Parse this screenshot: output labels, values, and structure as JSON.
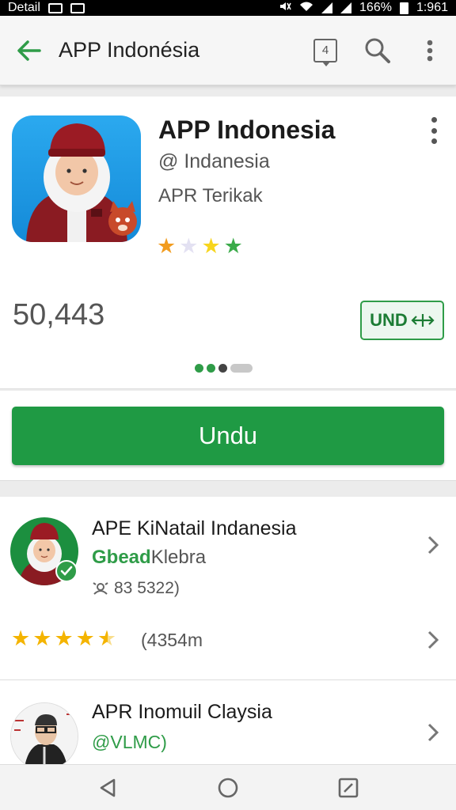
{
  "status_bar": {
    "left_text": "Detail",
    "right_percent": "166%",
    "time": "1:961"
  },
  "app_bar": {
    "title": "APP Indonésia",
    "badge": "4"
  },
  "app": {
    "title": "APP Indonesia",
    "developer": "@ Indanesia",
    "category": "APR Terikak",
    "rating_stars": [
      "orange",
      "lavender",
      "yellow",
      "green"
    ],
    "downloads": "50,443",
    "small_button_label": "UND",
    "install_label": "Undu"
  },
  "list": [
    {
      "title": "APE KiNatail Indanesia",
      "sub_green": "Gbead",
      "sub_gray": "Klebra",
      "meta": "83 5322)",
      "rating": 4.5,
      "reviews": "(4354m"
    },
    {
      "title": "APR Inomuil Claysia",
      "sub": "@VLMC)"
    }
  ],
  "colors": {
    "accent": "#1f9a44",
    "primary_text": "#1b1b1b",
    "secondary_text": "#555555"
  },
  "icons": [
    "back-arrow-icon",
    "notification-badge-icon",
    "search-icon",
    "more-vert-icon",
    "chevron-right-icon",
    "back-nav-icon",
    "home-nav-icon",
    "recents-nav-icon"
  ]
}
